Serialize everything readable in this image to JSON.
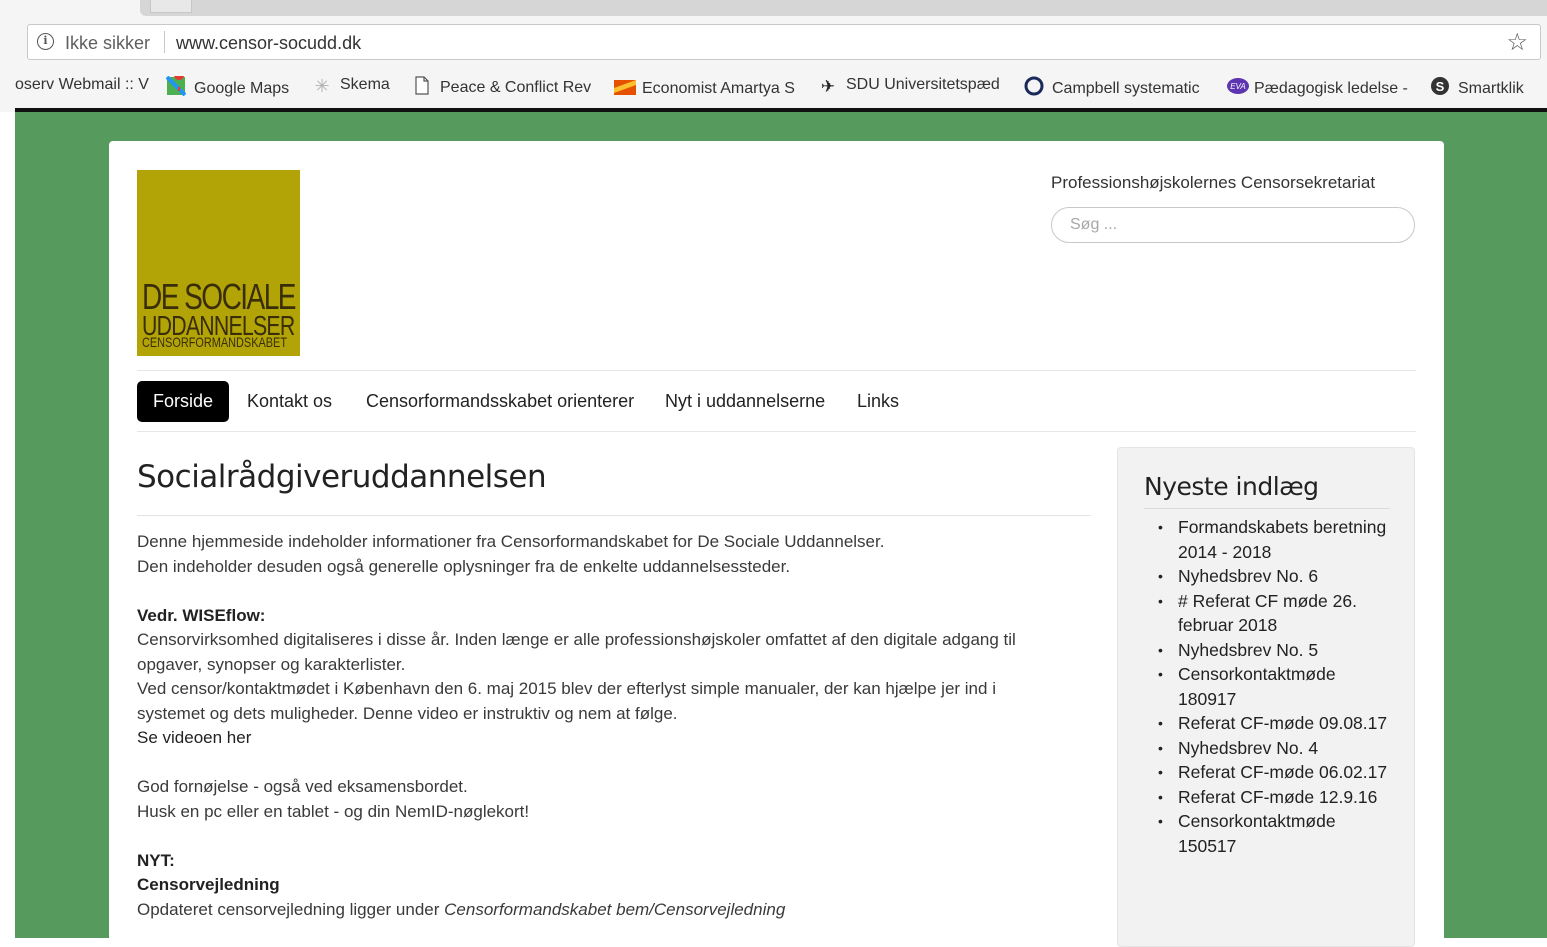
{
  "browser": {
    "not_secure_label": "Ikke sikker",
    "url": "www.censor-socudd.dk",
    "star_icon": "star-icon",
    "bookmarks": [
      {
        "label": "oserv Webmail :: V",
        "icon": "none"
      },
      {
        "label": "Google Maps",
        "icon": "maps-pin-icon"
      },
      {
        "label": "Skema",
        "icon": "snowflake-icon"
      },
      {
        "label": "Peace & Conflict Rev",
        "icon": "page-icon"
      },
      {
        "label": "Economist Amartya S",
        "icon": "economist-icon"
      },
      {
        "label": "SDU Universitetspæd",
        "icon": "sdu-icon"
      },
      {
        "label": "Campbell systematic",
        "icon": "circle-icon"
      },
      {
        "label": "Pædagogisk ledelse -",
        "icon": "eva-icon"
      },
      {
        "label": "Smartklik",
        "icon": "s-icon"
      }
    ]
  },
  "colors": {
    "page_background": "#579a5e",
    "logo_background": "#b2a406",
    "nav_active_background": "#000000"
  },
  "header": {
    "logo": {
      "line1": "DE SOCIALE",
      "line2": "UDDANNELSER",
      "line3": "CENSORFORMANDSKABET"
    },
    "tagline": "Professionshøjskolernes Censorsekretariat",
    "search_placeholder": "Søg ..."
  },
  "nav": {
    "items": [
      {
        "label": "Forside",
        "active": true
      },
      {
        "label": "Kontakt os",
        "active": false
      },
      {
        "label": "Censorformandsskabet orienterer",
        "active": false
      },
      {
        "label": "Nyt i uddannelserne",
        "active": false
      },
      {
        "label": "Links",
        "active": false
      }
    ]
  },
  "main": {
    "title": "Socialrådgiveruddannelsen",
    "intro_1": "Denne hjemmeside indeholder informationer fra Censorformandskabet for De Sociale Uddannelser.",
    "intro_2": "Den indeholder desuden også generelle oplysninger fra de enkelte uddannelsessteder.",
    "wiseflow_heading": "Vedr. WISEflow:",
    "wiseflow_1": "Censorvirksomhed digitaliseres i disse år. Inden længe er alle professionshøjskoler omfattet af den digitale adgang til",
    "wiseflow_2": "opgaver, synopser og karakterlister.",
    "wiseflow_3": "Ved censor/kontaktmødet i København den 6. maj 2015 blev der efterlyst simple manualer, der kan hjælpe jer ind i",
    "wiseflow_4": "systemet og dets muligheder. Denne video er instruktiv og nem at følge.",
    "video_link": "Se videoen her",
    "enjoy_1": "God fornøjelse - også ved eksamensbordet.",
    "enjoy_2": "Husk en pc eller en tablet - og din NemID-nøglekort!",
    "new_heading": "NYT:",
    "censorvejledning_heading": "Censorvejledning",
    "update_text": "Opdateret censorvejledning ligger under ",
    "update_path": "Censorformandskabet bem/Censorvejledning"
  },
  "sidebar": {
    "title": "Nyeste indlæg",
    "posts": [
      "Formandskabets beretning 2014 - 2018",
      "Nyhedsbrev No. 6",
      "# Referat CF møde 26. februar 2018",
      "Nyhedsbrev No. 5",
      "Censorkontaktmøde 180917",
      "Referat CF-møde 09.08.17",
      "Nyhedsbrev No. 4",
      "Referat CF-møde 06.02.17",
      "Referat CF-møde 12.9.16",
      "Censorkontaktmøde 150517"
    ]
  }
}
